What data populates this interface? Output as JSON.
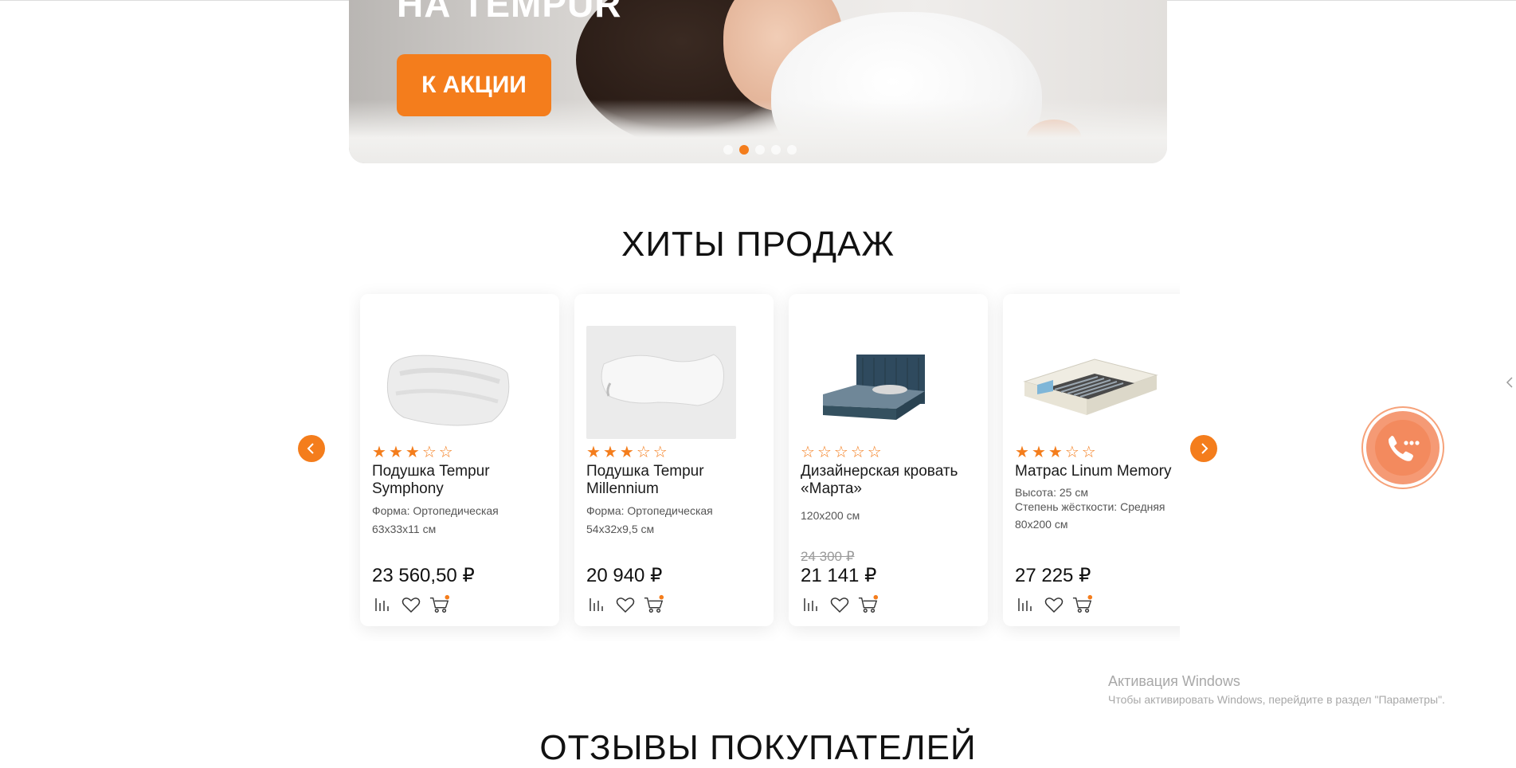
{
  "banner": {
    "title": "НА TEMPUR",
    "button_label": "К АКЦИИ",
    "slides_total": 5,
    "active_slide": 2
  },
  "hits": {
    "title": "ХИТЫ ПРОДАЖ",
    "products": [
      {
        "name": "Подушка Tempur Symphony",
        "rating": 3,
        "attrs": [
          "Форма: Ортопедическая",
          "63x33x11 см"
        ],
        "old_price": "",
        "price": "23 560,50 ₽",
        "image": "pillow-icon"
      },
      {
        "name": "Подушка Tempur Millennium",
        "rating": 3,
        "attrs": [
          "Форма: Ортопедическая",
          "54x32x9,5 см"
        ],
        "old_price": "",
        "price": "20 940 ₽",
        "image": "pillow-icon"
      },
      {
        "name": "Дизайнерская кровать «Марта»",
        "rating": 0,
        "attrs": [
          "120x200 см"
        ],
        "old_price": "24 300 ₽",
        "price": "21 141 ₽",
        "image": "bed-icon"
      },
      {
        "name": "Матрас Linum Memory",
        "rating": 3,
        "attrs": [
          "Высота: 25 см",
          "Степень жёсткости: Средняя",
          "80x200 см"
        ],
        "old_price": "",
        "price": "27 225 ₽",
        "image": "mattress-icon"
      }
    ]
  },
  "reviews": {
    "title": "ОТЗЫВЫ ПОКУПАТЕЛЕЙ"
  },
  "watermark": {
    "line1": "Активация Windows",
    "line2": "Чтобы активировать Windows, перейдите в раздел \"Параметры\"."
  },
  "colors": {
    "accent": "#f47d1c",
    "call": "#f59a75"
  }
}
